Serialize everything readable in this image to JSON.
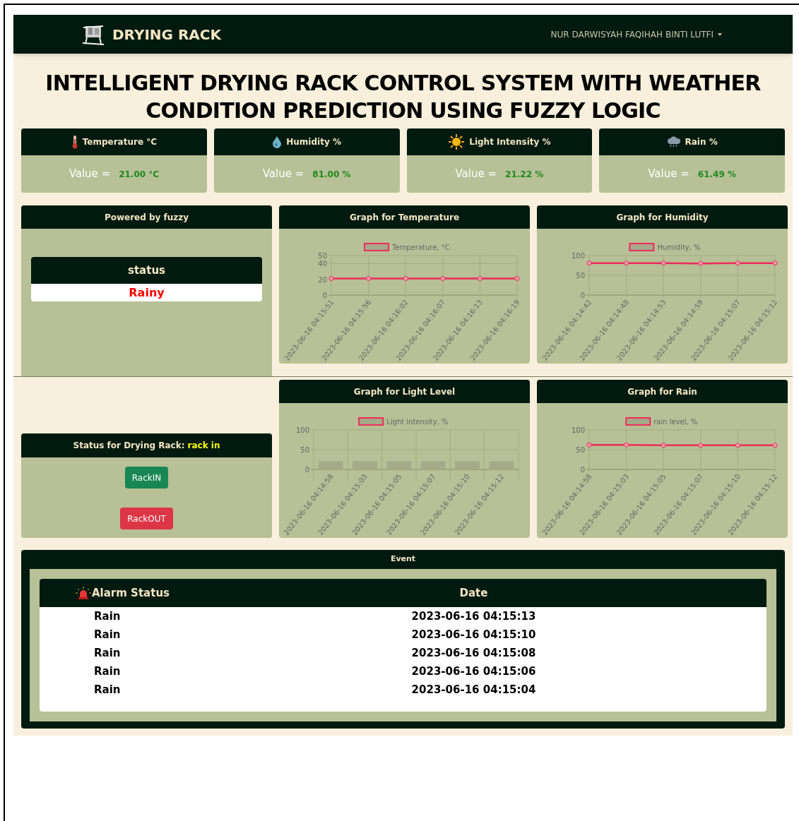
{
  "navbar": {
    "brand": "DRYING RACK",
    "user": "NUR DARWISYAH FAQIHAH BINTI LUTFI"
  },
  "title": "INTELLIGENT DRYING RACK CONTROL SYSTEM WITH WEATHER CONDITION PREDICTION USING FUZZY LOGIC",
  "sensors": [
    {
      "kind": "temperature",
      "label": "Temperature °C",
      "value_label": "Value =",
      "value": "21.00 °C"
    },
    {
      "kind": "humidity",
      "label": "Humidity %",
      "value_label": "Value =",
      "value": "81.00 %"
    },
    {
      "kind": "light",
      "label": "Light Intensity %",
      "value_label": "Value =",
      "value": "21.22 %"
    },
    {
      "kind": "rain",
      "label": "Rain %",
      "value_label": "Value =",
      "value": "61.49 %"
    }
  ],
  "fuzzy": {
    "title": "Powered by fuzzy",
    "status_label": "status",
    "status": "Rainy"
  },
  "charts": [
    {
      "title": "Graph for Temperature",
      "chart_data": {
        "type": "line",
        "categories": [
          "2023-06-16 04:15:51",
          "2023-06-16 04:15:56",
          "2023-06-16 04:16:02",
          "2023-06-16 04:16:07",
          "2023-06-16 04:16:13",
          "2023-06-16 04:16:19"
        ],
        "grid": true,
        "series": [
          {
            "name": "Temperature, °C",
            "color": "#ef2c5c",
            "marker": "circle",
            "values": [
              21,
              21,
              21,
              21,
              21,
              21
            ]
          }
        ],
        "ylim": [
          0,
          50
        ],
        "yticks": [
          0,
          20,
          40,
          50
        ]
      }
    },
    {
      "title": "Graph for Humidity",
      "chart_data": {
        "type": "line",
        "categories": [
          "2023-06-16 04:14:42",
          "2023-06-16 04:14:48",
          "2023-06-16 04:14:53",
          "2023-06-16 04:14:59",
          "2023-06-16 04:15:07",
          "2023-06-16 04:15:12"
        ],
        "grid": true,
        "series": [
          {
            "name": "Humidity, %",
            "color": "#ef2c5c",
            "marker": "circle",
            "values": [
              81,
              81,
              81,
              80,
              81,
              81
            ]
          }
        ],
        "ylim": [
          0,
          100
        ],
        "yticks": [
          0,
          50,
          100
        ]
      }
    },
    {
      "title": "Graph for Light Level",
      "chart_data": {
        "type": "bar",
        "categories": [
          "2023-06-16 04:14:58",
          "2023-06-16 04:15:03",
          "2023-06-16 04:15:05",
          "2023-06-16 04:15:07",
          "2023-06-16 04:15:10",
          "2023-06-16 04:15:12"
        ],
        "grid": true,
        "series": [
          {
            "name": "Light intensity, %",
            "color": "#a5aa89",
            "values": [
              21,
              21,
              21,
              21,
              21,
              21
            ]
          }
        ],
        "ylim": [
          0,
          100
        ],
        "yticks": [
          0,
          50,
          100
        ]
      }
    },
    {
      "title": "Graph for Rain",
      "chart_data": {
        "type": "line",
        "categories": [
          "2023-06-16 04:14:58",
          "2023-06-16 04:15:03",
          "2023-06-16 04:15:05",
          "2023-06-16 04:15:07",
          "2023-06-16 04:15:10",
          "2023-06-16 04:15:12"
        ],
        "grid": true,
        "series": [
          {
            "name": "rain level, %",
            "color": "#ef2c5c",
            "marker": "circle",
            "values": [
              62,
              62,
              61,
              61,
              61,
              61
            ]
          }
        ],
        "ylim": [
          0,
          100
        ],
        "yticks": [
          0,
          50,
          100
        ]
      }
    }
  ],
  "rack": {
    "label": "Status for Drying Rack:",
    "state": "rack in",
    "buttons": [
      {
        "kind": "in",
        "label": "RackIN"
      },
      {
        "kind": "out",
        "label": "RackOUT"
      }
    ]
  },
  "event": {
    "title": "Event",
    "columns": [
      "Alarm Status",
      "Date"
    ],
    "rows": [
      [
        "Rain",
        "2023-06-16 04:15:13"
      ],
      [
        "Rain",
        "2023-06-16 04:15:10"
      ],
      [
        "Rain",
        "2023-06-16 04:15:08"
      ],
      [
        "Rain",
        "2023-06-16 04:15:06"
      ],
      [
        "Rain",
        "2023-06-16 04:15:04"
      ]
    ]
  }
}
